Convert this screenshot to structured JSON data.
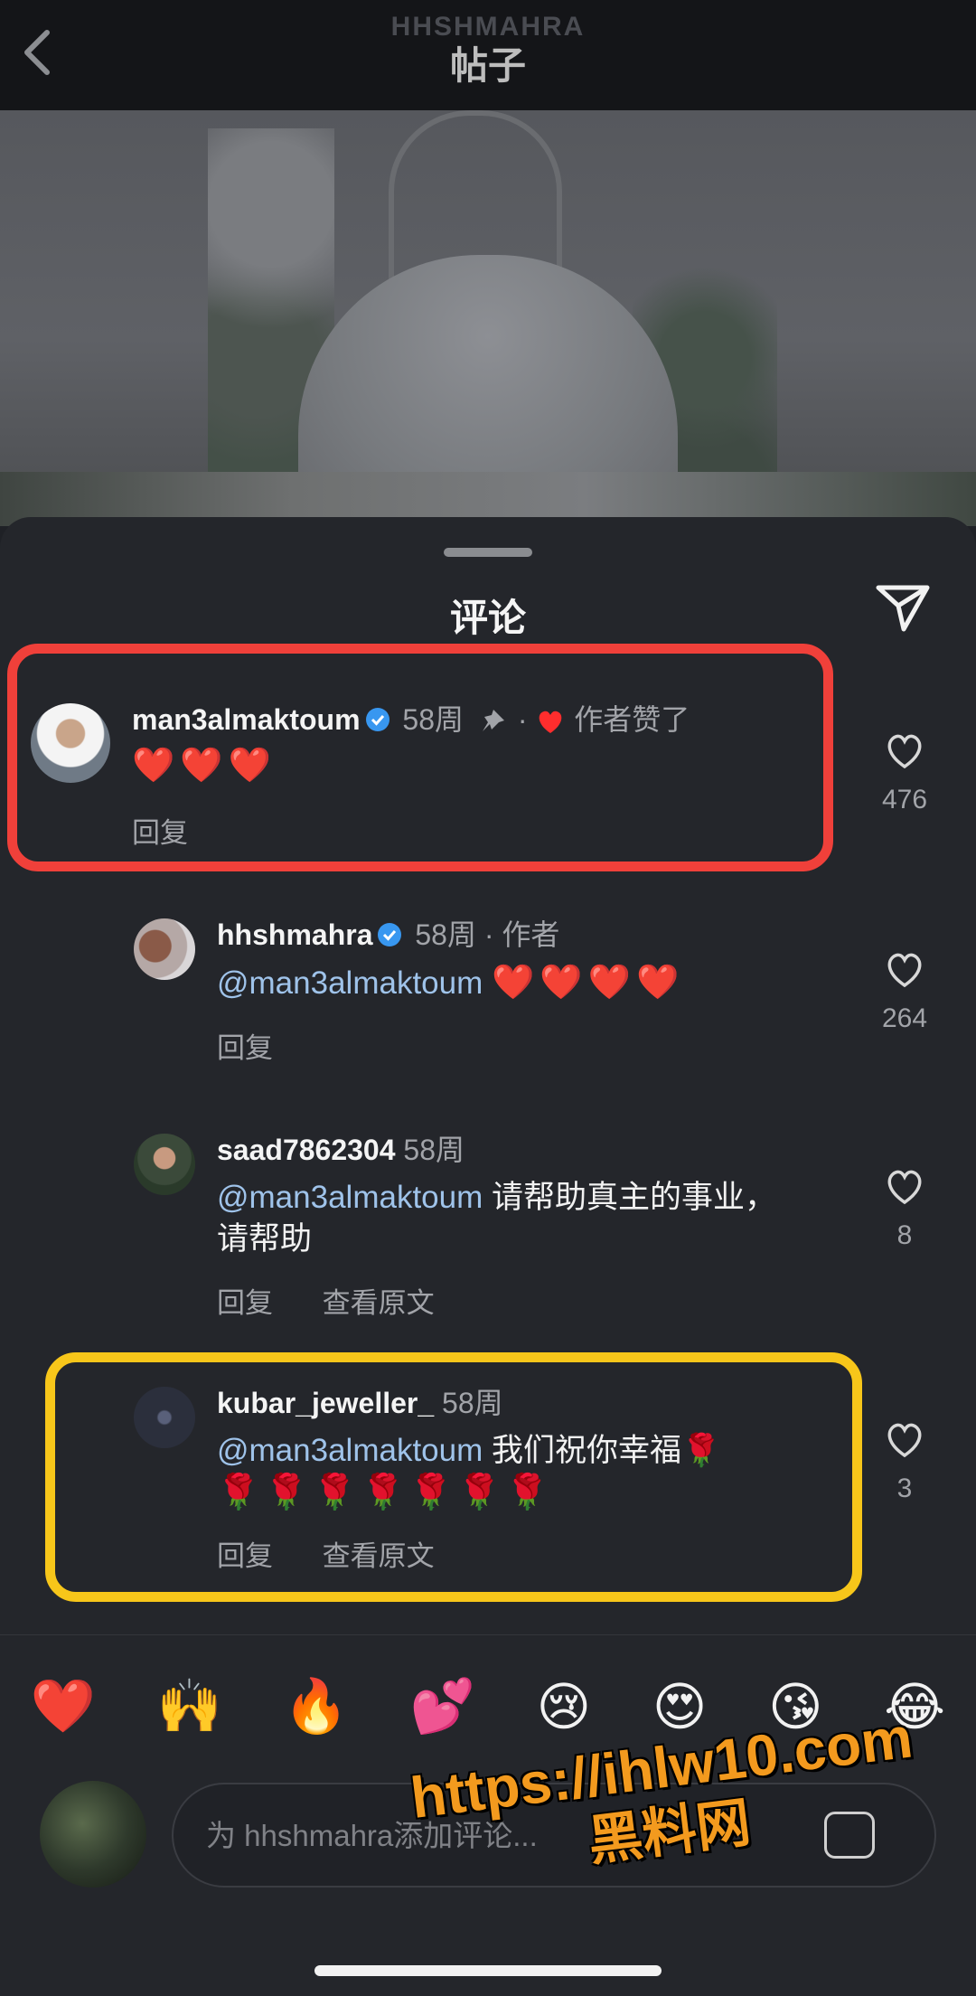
{
  "header": {
    "account_name": "HHSHMAHRA",
    "title": "帖子"
  },
  "sheet": {
    "title": "评论"
  },
  "comments": [
    {
      "username": "man3almaktoum",
      "verified": true,
      "time": "58周",
      "pinned": true,
      "liked_by_author_label": "作者赞了",
      "text": "❤️❤️❤️",
      "reply_label": "回复",
      "like_count": "476"
    },
    {
      "username": "hhshmahra",
      "verified": true,
      "time": "58周",
      "author_label": "作者",
      "mention": "@man3almaktoum",
      "text": "❤️❤️❤️❤️",
      "reply_label": "回复",
      "like_count": "264"
    },
    {
      "username": "saad7862304",
      "time": "58周",
      "mention": "@man3almaktoum",
      "text": "请帮助真主的事业，",
      "text_line2": "请帮助",
      "reply_label": "回复",
      "translate_label": "查看原文",
      "like_count": "8"
    },
    {
      "username": "kubar_jeweller_",
      "time": "58周",
      "mention": "@man3almaktoum",
      "text": "我们祝你幸福🌹",
      "text_line2": "🌹🌹🌹🌹🌹🌹🌹",
      "reply_label": "回复",
      "translate_label": "查看原文",
      "like_count": "3"
    }
  ],
  "quick_reactions": [
    "❤️",
    "🙌",
    "🔥",
    "💕",
    "😢",
    "😍",
    "😘",
    "😂"
  ],
  "composer": {
    "placeholder": "为 hhshmahra添加评论..."
  },
  "watermark": {
    "url": "https://ihlw10.com",
    "name": "黑料网"
  },
  "colors": {
    "highlight_red": "#f0403a",
    "highlight_yellow": "#f7c61a",
    "mention": "#9fc3ea",
    "verified_badge": "#3897f0",
    "watermark": "#f39a1e"
  },
  "icons": [
    "back-chevron-icon",
    "share-paper-plane-icon",
    "verified-badge-icon",
    "pin-icon",
    "heart-icon",
    "gif-sticker-icon"
  ]
}
